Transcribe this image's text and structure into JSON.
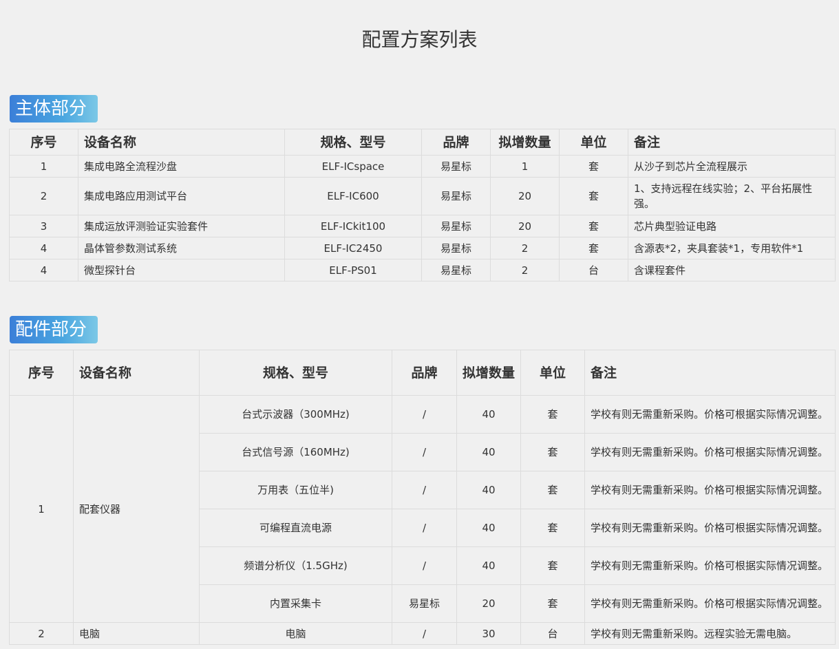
{
  "page": {
    "title": "配置方案列表"
  },
  "main_section": {
    "title": "主体部分",
    "headers": [
      "序号",
      "设备名称",
      "规格、型号",
      "品牌",
      "拟增数量",
      "单位",
      "备注"
    ],
    "rows": [
      {
        "no": "1",
        "name": "集成电路全流程沙盘",
        "model": "ELF-ICspace",
        "brand": "易星标",
        "qty": "1",
        "unit": "套",
        "note": "从沙子到芯片全流程展示"
      },
      {
        "no": "2",
        "name": "集成电路应用测试平台",
        "model": "ELF-IC600",
        "brand": "易星标",
        "qty": "20",
        "unit": "套",
        "note": "1、支持远程在线实验；2、平台拓展性强。"
      },
      {
        "no": "3",
        "name": "集成运放评测验证实验套件",
        "model": "ELF-ICkit100",
        "brand": "易星标",
        "qty": "20",
        "unit": "套",
        "note": "芯片典型验证电路"
      },
      {
        "no": "4",
        "name": "晶体管参数测试系统",
        "model": "ELF-IC2450",
        "brand": "易星标",
        "qty": "2",
        "unit": "套",
        "note": "含源表*2，夹具套装*1，专用软件*1"
      },
      {
        "no": "4",
        "name": "微型探针台",
        "model": "ELF-PS01",
        "brand": "易星标",
        "qty": "2",
        "unit": "台",
        "note": "含课程套件"
      }
    ]
  },
  "accessory_section": {
    "title": "配件部分",
    "headers": [
      "序号",
      "设备名称",
      "规格、型号",
      "品牌",
      "拟增数量",
      "单位",
      "备注"
    ],
    "group1": {
      "no": "1",
      "name": "配套仪器",
      "items": [
        {
          "model": "台式示波器（300MHz)",
          "brand": "/",
          "qty": "40",
          "unit": "套",
          "note": "学校有则无需重新采购。价格可根据实际情况调整。"
        },
        {
          "model": "台式信号源（160MHz)",
          "brand": "/",
          "qty": "40",
          "unit": "套",
          "note": "学校有则无需重新采购。价格可根据实际情况调整。"
        },
        {
          "model": "万用表（五位半)",
          "brand": "/",
          "qty": "40",
          "unit": "套",
          "note": "学校有则无需重新采购。价格可根据实际情况调整。"
        },
        {
          "model": "可编程直流电源",
          "brand": "/",
          "qty": "40",
          "unit": "套",
          "note": "学校有则无需重新采购。价格可根据实际情况调整。"
        },
        {
          "model": "频谱分析仪（1.5GHz)",
          "brand": "/",
          "qty": "40",
          "unit": "套",
          "note": "学校有则无需重新采购。价格可根据实际情况调整。"
        },
        {
          "model": "内置采集卡",
          "brand": "易星标",
          "qty": "20",
          "unit": "套",
          "note": "学校有则无需重新采购。价格可根据实际情况调整。"
        }
      ]
    },
    "row2": {
      "no": "2",
      "name": "电脑",
      "model": "电脑",
      "brand": "/",
      "qty": "30",
      "unit": "台",
      "note": "学校有则无需重新采购。远程实验无需电脑。"
    }
  }
}
